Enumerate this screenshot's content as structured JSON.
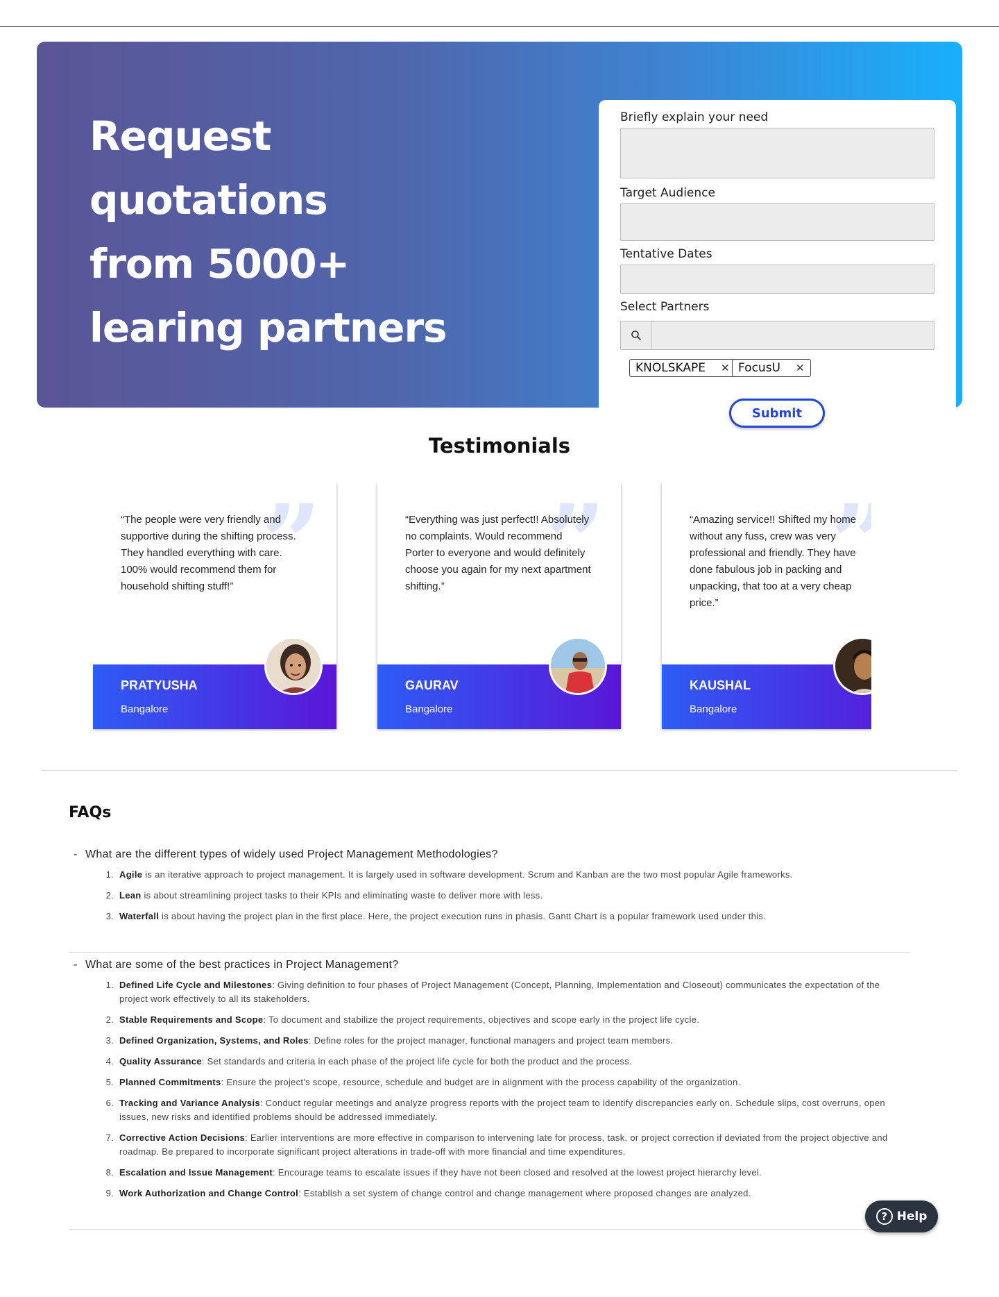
{
  "hero": {
    "title_lines": [
      "Request quotations",
      "from 5000+",
      "learing partners"
    ]
  },
  "form": {
    "need_label": "Briefly explain your need",
    "need_value": "",
    "audience_label": "Target Audience",
    "audience_value": "",
    "dates_label": "Tentative Dates",
    "dates_value": "",
    "partners_label": "Select Partners",
    "partners_search_value": "",
    "chips": [
      "KNOLSKAPE",
      "FocusU"
    ],
    "submit_label": "Submit"
  },
  "testimonials": {
    "title": "Testimonials",
    "items": [
      {
        "text": "“The people were very friendly and supportive during the shifting process. They handled everything with care. 100% would recommend them for household shifting stuff!”",
        "name": "PRATYUSHA",
        "city": "Bangalore"
      },
      {
        "text": "“Everything was just perfect!! Absolutely no complaints. Would recommend Porter to everyone and would definitely choose you again for my next apartment shifting.”",
        "name": "GAURAV",
        "city": "Bangalore"
      },
      {
        "text": "“Amazing service!! Shifted my home without any fuss, crew was very professional and friendly. They have done fabulous job in packing and unpacking, that too at a very cheap price.”",
        "name": "KAUSHAL",
        "city": "Bangalore"
      }
    ]
  },
  "faqs": {
    "title": "FAQs",
    "items": [
      {
        "question": "What are the different types of widely used Project Management Methodologies?",
        "answers": [
          {
            "term": "Agile",
            "text": " is an iterative approach to project management. It is largely used in software development. Scrum and Kanban are the two most popular Agile frameworks."
          },
          {
            "term": "Lean",
            "text": " is about streamlining project tasks to their KPIs and eliminating waste to deliver more with less."
          },
          {
            "term": "Waterfall",
            "text": " is about having the project plan in the first place. Here, the project execution runs in phasis. Gantt Chart is a popular framework used under this."
          }
        ]
      },
      {
        "question": "What are some of the best practices in Project Management?",
        "answers": [
          {
            "term": "Defined Life Cycle and Milestones",
            "text": ": Giving definition to four phases of Project Management (Concept, Planning, Implementation and Closeout) communicates the expectation of the project work effectively to all its stakeholders."
          },
          {
            "term": "Stable Requirements and Scope",
            "text": ": To document and stabilize the project requirements, objectives and scope early in the project life cycle."
          },
          {
            "term": "Defined Organization, Systems, and Roles",
            "text": ": Define roles for the project manager, functional managers and project team members."
          },
          {
            "term": "Quality Assurance",
            "text": ": Set standards and criteria in each phase of the project life cycle for both the product and the process."
          },
          {
            "term": "Planned Commitments",
            "text": ": Ensure the project's scope, resource, schedule and budget are in alignment with the process capability of the organization."
          },
          {
            "term": "Tracking and Variance Analysis",
            "text": ": Conduct regular meetings and analyze progress reports with the project team to identify discrepancies early on. Schedule slips, cost overruns, open issues, new risks and identified problems should be addressed immediately."
          },
          {
            "term": "Corrective Action Decisions",
            "text": ": Earlier interventions are more effective in comparison to intervening late for process, task, or project correction if deviated from the project objective and roadmap. Be prepared to incorporate significant project alterations in trade-off with more financial and time expenditures."
          },
          {
            "term": "Escalation and Issue Management",
            "text": ": Encourage teams to escalate issues if they have not been closed and resolved at the lowest project hierarchy level."
          },
          {
            "term": "Work Authorization and Change Control",
            "text": ": Establish a set system of change control and change management where proposed changes are analyzed."
          }
        ]
      }
    ]
  },
  "help": {
    "label": "Help",
    "icon_glyph": "?"
  }
}
